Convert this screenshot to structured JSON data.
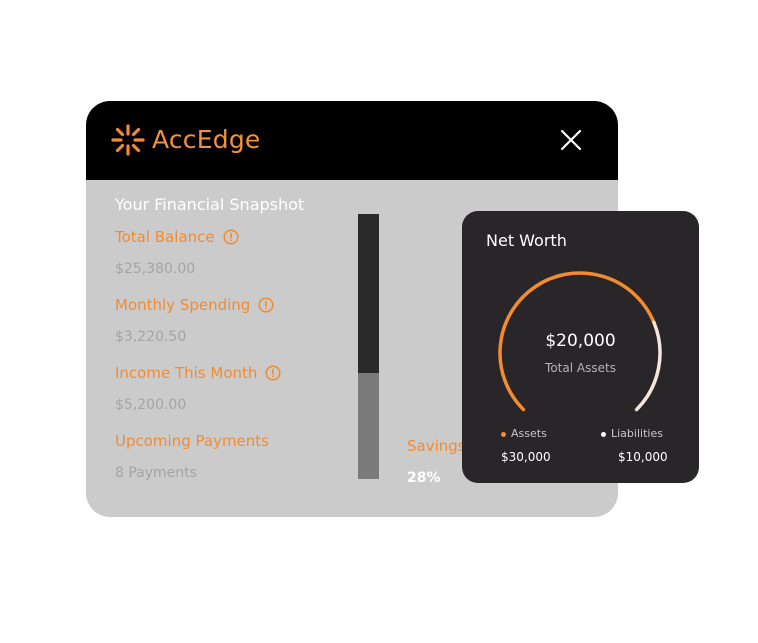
{
  "app": {
    "brand": "AccEdge"
  },
  "snapshot": {
    "title": "Your Financial Snapshot",
    "metrics": [
      {
        "label": "Total Balance",
        "value": "$25,380.00",
        "info": true
      },
      {
        "label": "Monthly Spending",
        "value": "$3,220.50",
        "info": true
      },
      {
        "label": "Income This Month",
        "value": "$5,200.00",
        "info": true
      },
      {
        "label": "Upcoming Payments",
        "value": "8 Payments",
        "info": false
      }
    ],
    "savings": {
      "label": "Savings",
      "value": "28%",
      "fraction": 0.4
    }
  },
  "net_worth": {
    "title": "Net Worth",
    "amount": "$20,000",
    "amount_label": "Total Assets",
    "gauge_fraction": 0.75,
    "assets": {
      "label": "Assets",
      "value": "$30,000"
    },
    "liabilities": {
      "label": "Liabilities",
      "value": "$10,000"
    }
  },
  "colors": {
    "accent": "#f28b31",
    "window_body": "#cbcbcb",
    "titlebar": "#000000",
    "card_bg": "#282628",
    "liabilities_arc": "#f5e6dc"
  },
  "icons": {
    "logo": "starburst-logo-icon",
    "close": "close-icon",
    "info": "info-circle-icon"
  }
}
